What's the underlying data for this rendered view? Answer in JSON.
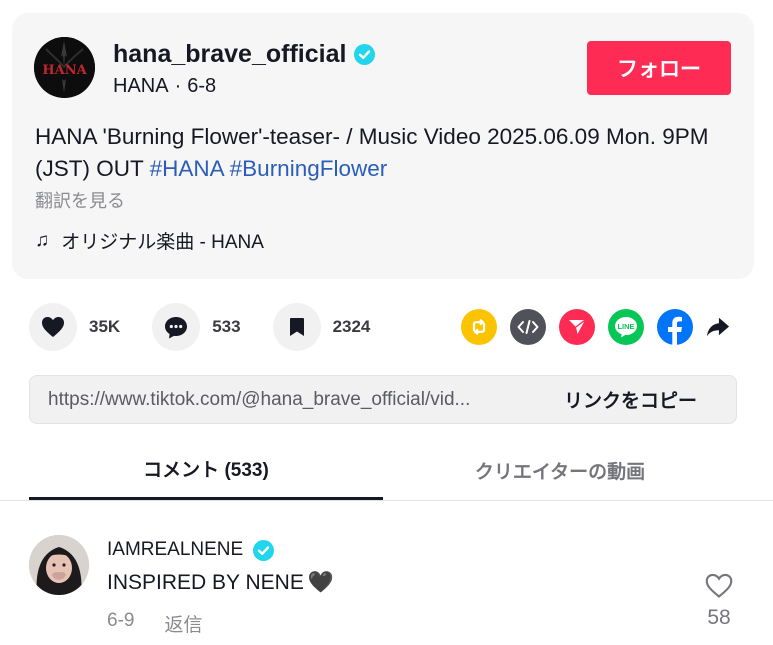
{
  "post": {
    "username": "hana_brave_official",
    "avatar_text": "HANA",
    "author_name": "HANA",
    "separator": "·",
    "date": "6-8",
    "follow_label": "フォロー",
    "description_text": "HANA 'Burning Flower'-teaser- / Music Video 2025.06.09 Mon. 9PM (JST) OUT",
    "hashtags": [
      "#HANA",
      "#BurningFlower"
    ],
    "translate_label": "翻訳を見る",
    "music_icon": "♫",
    "music_label": "オリジナル楽曲 - HANA"
  },
  "actions": {
    "likes": "35K",
    "comments": "533",
    "saves": "2324"
  },
  "share": {
    "icons": [
      "repost-icon",
      "embed-icon",
      "send-icon",
      "line-icon",
      "facebook-icon",
      "share-arrow-icon"
    ],
    "colors": {
      "repost": "#fcc400",
      "embed": "#515259",
      "send": "#fe2c55",
      "line": "#06c755",
      "facebook": "#0075fa"
    }
  },
  "link": {
    "url": "https://www.tiktok.com/@hana_brave_official/vid...",
    "copy_label": "リンクをコピー"
  },
  "tabs": {
    "comments": "コメント (533)",
    "creator_videos": "クリエイターの動画"
  },
  "comments": [
    {
      "username": "IAMREALNENE",
      "text": "INSPIRED BY NENE",
      "emoji": "🖤",
      "date": "6-9",
      "reply_label": "返信",
      "likes": "58"
    }
  ],
  "colors": {
    "accent": "#fe2c55",
    "verified": "#20d5ec",
    "hashtag": "#2b5db9"
  }
}
